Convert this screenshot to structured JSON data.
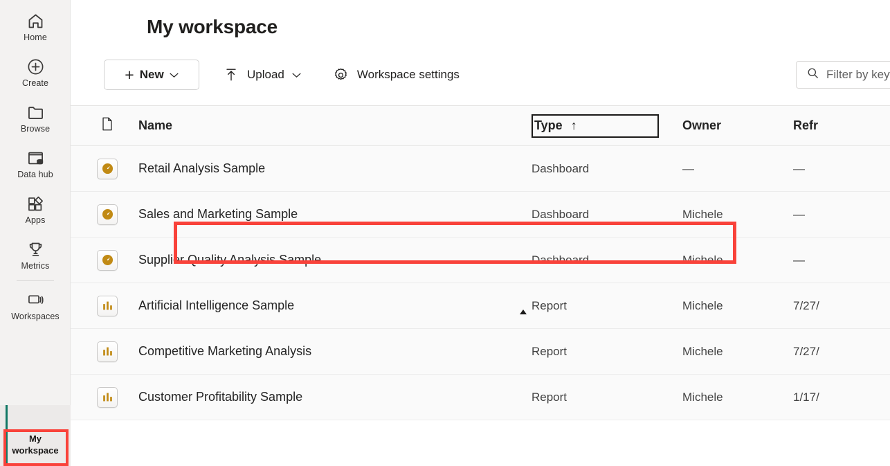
{
  "sidebar": {
    "items": [
      {
        "label": "Home",
        "icon": "home-icon"
      },
      {
        "label": "Create",
        "icon": "plus-circle-icon"
      },
      {
        "label": "Browse",
        "icon": "folder-icon"
      },
      {
        "label": "Data hub",
        "icon": "data-hub-icon"
      },
      {
        "label": "Apps",
        "icon": "apps-icon"
      },
      {
        "label": "Metrics",
        "icon": "trophy-icon"
      },
      {
        "label": "Workspaces",
        "icon": "workspaces-icon"
      }
    ],
    "current_workspace": "My\nworkspace",
    "current_workspace_line1": "My",
    "current_workspace_line2": "workspace",
    "accent_color": "#117865",
    "highlight_color": "#f9423a"
  },
  "header": {
    "title": "My workspace"
  },
  "toolbar": {
    "new_label": "New",
    "new_plus": "+",
    "new_chevron": "⌄",
    "upload_label": "Upload",
    "upload_chevron": "⌄",
    "upload_icon": "upload-icon",
    "settings_label": "Workspace settings",
    "settings_icon": "gear-icon"
  },
  "search": {
    "placeholder": "Filter by keyword",
    "value": "",
    "icon": "search-icon"
  },
  "table": {
    "columns": {
      "icon": "file-icon",
      "name": "Name",
      "type": "Type",
      "sort_indicator": "↑",
      "owner": "Owner",
      "refreshed": "Refr"
    },
    "rows": [
      {
        "icon": "dashboard-icon",
        "name": "Retail Analysis Sample",
        "type": "Dashboard",
        "owner": "—",
        "refreshed": "—"
      },
      {
        "icon": "dashboard-icon",
        "name": "Sales and Marketing Sample",
        "type": "Dashboard",
        "owner": "Michele",
        "refreshed": "—"
      },
      {
        "icon": "dashboard-icon",
        "name": "Supplier Quality Analysis Sample",
        "type": "Dashboard",
        "owner": "Michele",
        "refreshed": "—"
      },
      {
        "icon": "report-icon",
        "name": "Artificial Intelligence Sample",
        "type": "Report",
        "owner": "Michele",
        "refreshed": "7/27/"
      },
      {
        "icon": "report-icon",
        "name": "Competitive Marketing Analysis",
        "type": "Report",
        "owner": "Michele",
        "refreshed": "7/27/"
      },
      {
        "icon": "report-icon",
        "name": "Customer Profitability Sample",
        "type": "Report",
        "owner": "Michele",
        "refreshed": "1/17/"
      }
    ],
    "highlighted_row_index": 1
  },
  "colors": {
    "item_icon": "#c18a14",
    "highlight": "#f9423a",
    "workspace_accent": "#117865"
  }
}
